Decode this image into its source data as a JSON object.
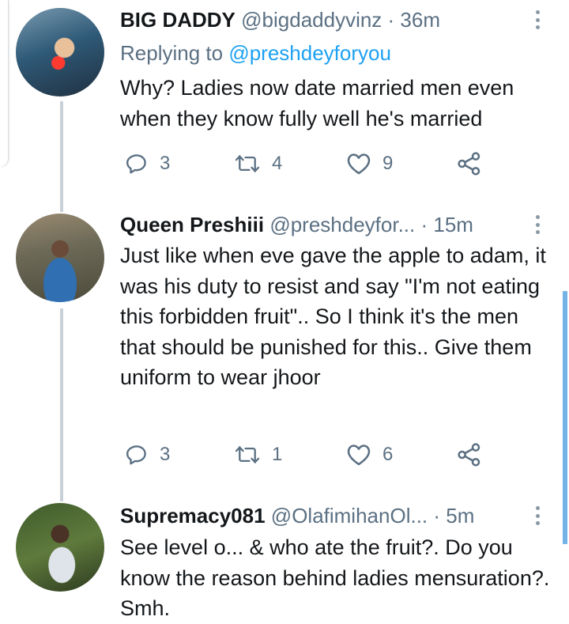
{
  "tweets": [
    {
      "name": "BIG DADDY",
      "handle": "@bigdaddyvinz",
      "time": "· 36m",
      "reply_prefix": "Replying to ",
      "reply_handle": "@preshdeyforyou",
      "text": "Why? Ladies now date married men even when they know fully well he's married",
      "replies": "3",
      "retweets": "4",
      "likes": "9"
    },
    {
      "name": "Queen Preshiii",
      "handle": "@preshdeyfor...",
      "time": "· 15m",
      "text": "Just like when eve gave the apple to adam, it was his duty to resist and say \"I'm not eating this forbidden fruit\".. So I think it's the men that should be punished for this.. Give them uniform to wear jhoor",
      "replies": "3",
      "retweets": "1",
      "likes": "6"
    },
    {
      "name": "Supremacy081",
      "handle": "@OlafimihanOl...",
      "time": "· 5m",
      "text": "See level o... & who ate the fruit?. Do you know the reason behind ladies mensuration?. Smh."
    }
  ],
  "colors": {
    "accent": "#1da1f2",
    "secondary_text": "#5b7083",
    "primary_text": "#14171a",
    "thread_line": "#c8d1d8",
    "scrollbar": "#74b3e6"
  },
  "icons": [
    "reply-icon",
    "retweet-icon",
    "like-icon",
    "share-icon",
    "more-icon"
  ]
}
